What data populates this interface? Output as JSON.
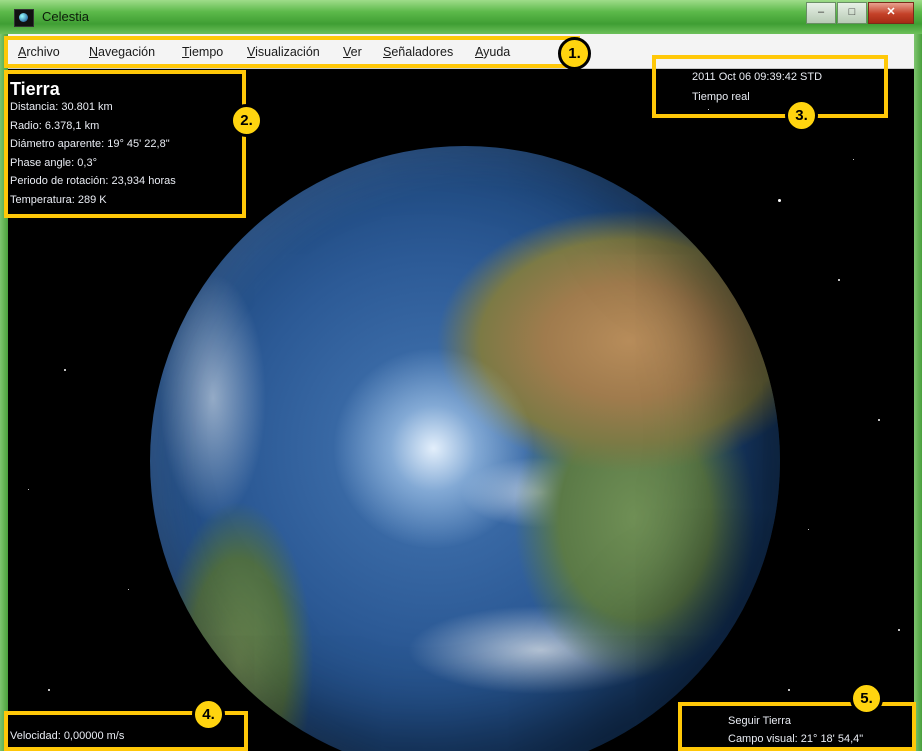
{
  "window": {
    "title": "Celestia",
    "buttons": [
      "minimize",
      "maximize",
      "close"
    ]
  },
  "menubar": {
    "items": [
      {
        "label": "Archivo"
      },
      {
        "label": "Navegación"
      },
      {
        "label": "Tiempo"
      },
      {
        "label": "Visualización"
      },
      {
        "label": "Ver"
      },
      {
        "label": "Señaladores"
      },
      {
        "label": "Ayuda"
      }
    ]
  },
  "object_info": {
    "name": "Tierra",
    "lines": [
      "Distancia: 30.801 km",
      "Radio: 6.378,1 km",
      "Diámetro aparente: 19° 45' 22,8\"",
      "Phase angle: 0,3°",
      "Periodo de rotación: 23,934 horas",
      "Temperatura: 289 K"
    ]
  },
  "time_info": {
    "datetime": "2011 Oct 06 09:39:42 STD",
    "mode": "Tiempo real"
  },
  "speed_info": {
    "text": "Velocidad: 0,00000 m/s"
  },
  "follow_info": {
    "follow": "Seguir Tierra",
    "fov": "Campo visual: 21° 18' 54,4\""
  },
  "annotations": [
    "1.",
    "2.",
    "3.",
    "4.",
    "5."
  ],
  "colors": {
    "highlight": "#ffc808",
    "titlebar": "#5cb94a",
    "menubar": "#f4f4f4",
    "space": "#000000"
  }
}
